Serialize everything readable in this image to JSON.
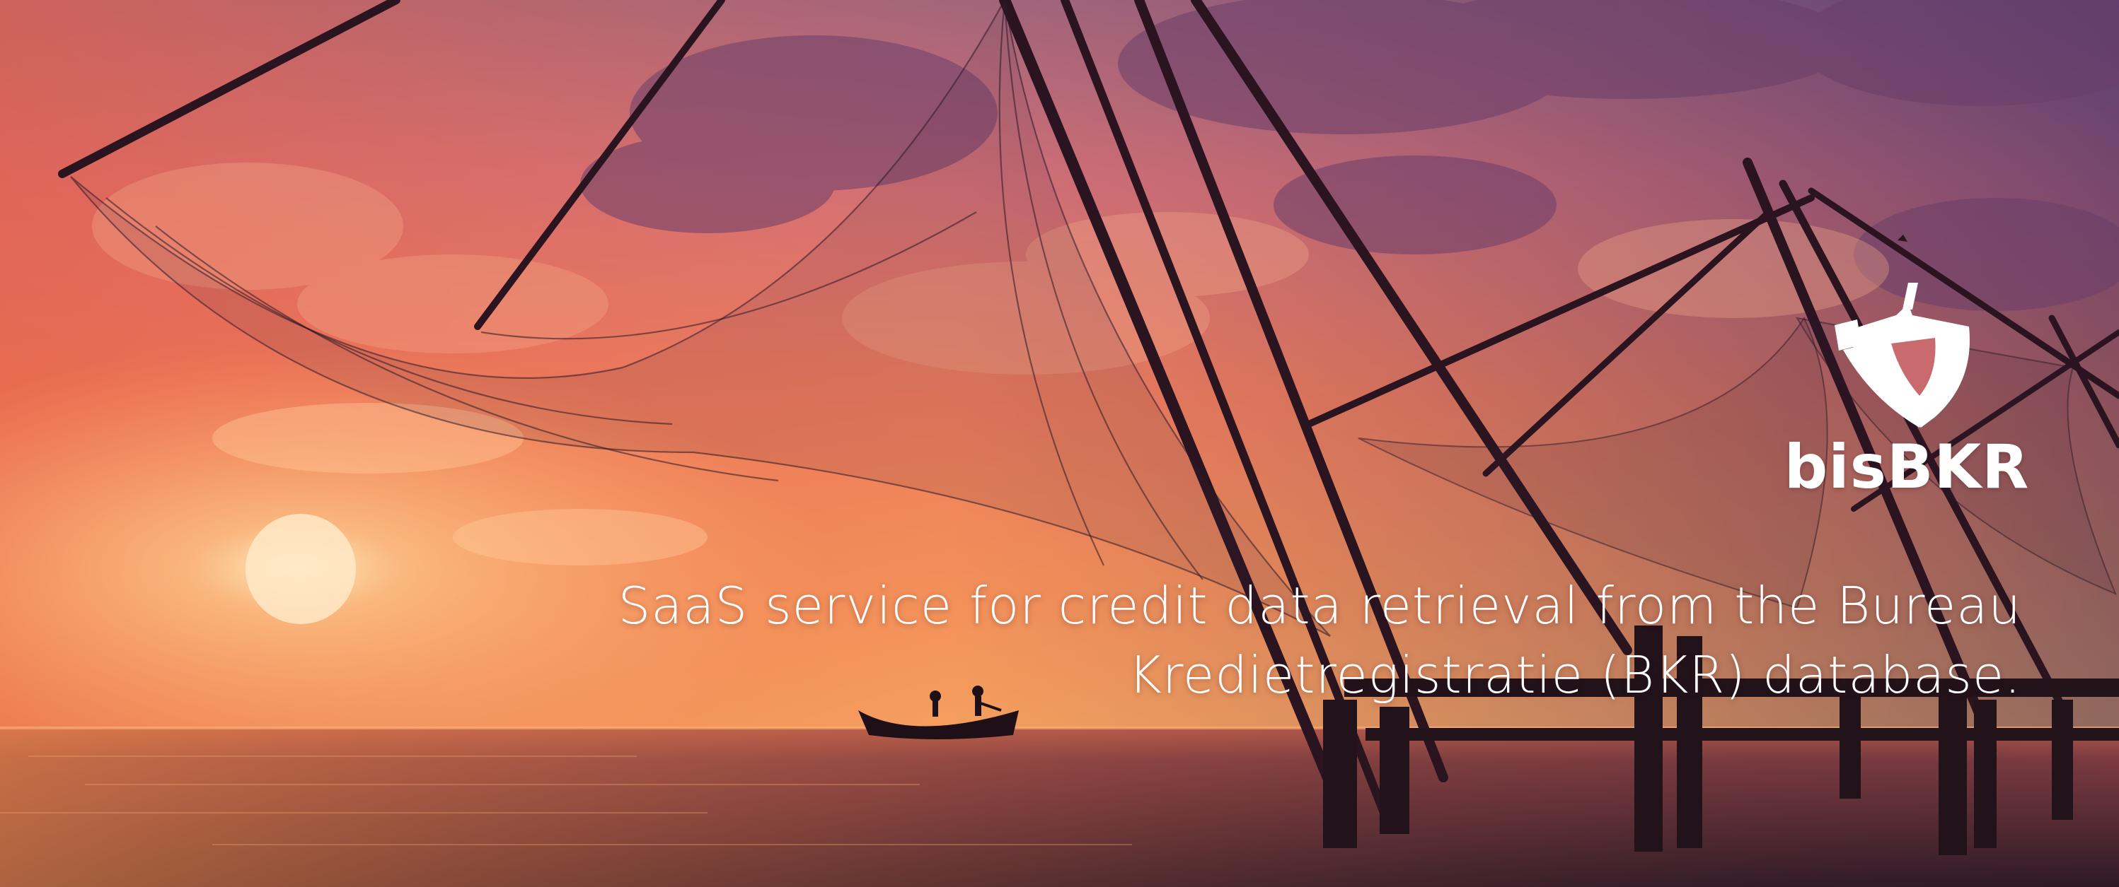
{
  "brand": {
    "name": "bisBKR",
    "logo_icon": "shield-icon"
  },
  "tagline": {
    "line1": "SaaS service for credit data retrieval from the Bureau",
    "line2": "Kredietregistratie (BKR) database."
  },
  "colors": {
    "sky_top": "#8b5a88",
    "sky_mid": "#ee8260",
    "horizon": "#f8b060",
    "sea": "#3a2230",
    "text": "#ffffff"
  }
}
